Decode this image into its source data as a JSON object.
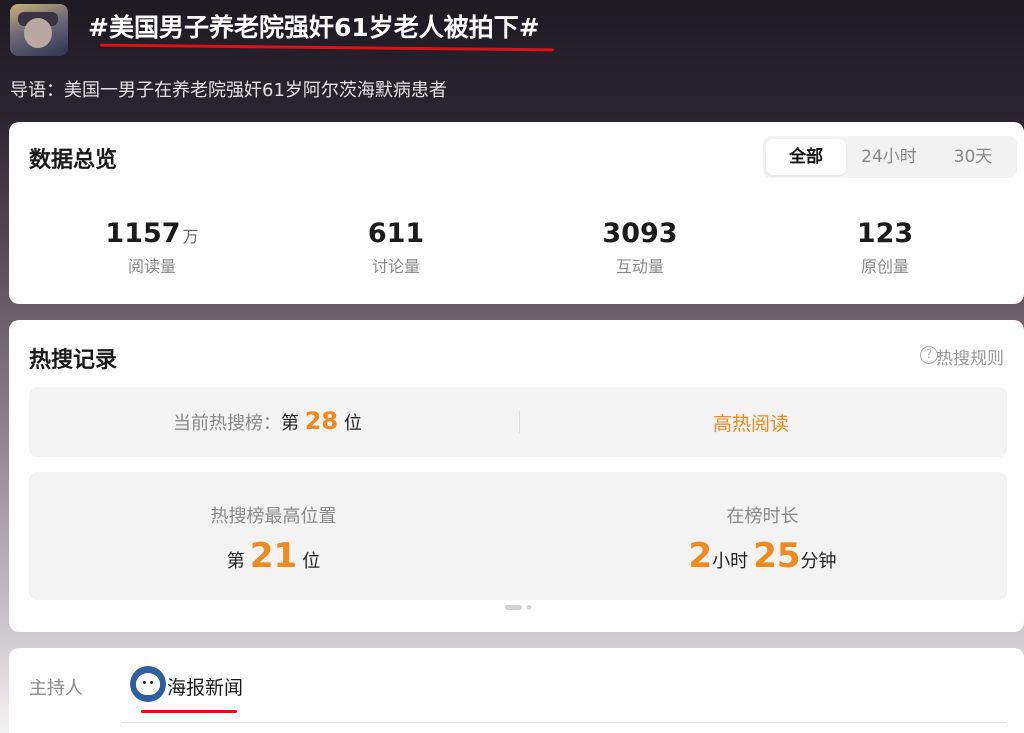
{
  "header": {
    "topic_title": "#美国男子养老院强奸61岁老人被拍下#",
    "intro_label": "导语：",
    "intro_text": "美国一男子在养老院强奸61岁阿尔茨海默病患者"
  },
  "overview": {
    "title": "数据总览",
    "filters": [
      "全部",
      "24小时",
      "30天"
    ],
    "active_filter": "全部",
    "stats": [
      {
        "value": "1157",
        "unit": "万",
        "label": "阅读量"
      },
      {
        "value": "611",
        "unit": "",
        "label": "讨论量"
      },
      {
        "value": "3093",
        "unit": "",
        "label": "互动量"
      },
      {
        "value": "123",
        "unit": "",
        "label": "原创量"
      }
    ]
  },
  "hot_search": {
    "title": "热搜记录",
    "rules_label": "热搜规则",
    "current_rank_label": "当前热搜榜：",
    "rank_prefix": "第",
    "current_rank": "28",
    "rank_suffix": "位",
    "hot_read_label": "高热阅读",
    "highest_label": "热搜榜最高位置",
    "highest_rank": "21",
    "duration_label": "在榜时长",
    "duration_hours": "2",
    "hours_unit": "小时",
    "duration_minutes": "25",
    "minutes_unit": "分钟"
  },
  "host": {
    "label": "主持人",
    "name": "海报新闻"
  },
  "colors": {
    "accent_orange": "#f08a1c",
    "underline_red": "#e01018"
  }
}
